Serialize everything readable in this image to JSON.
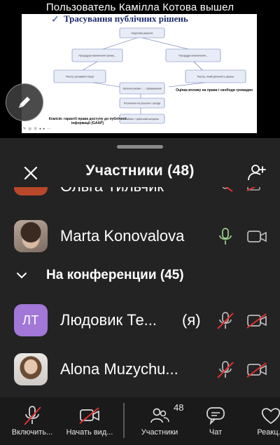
{
  "notification": {
    "text": "Пользователь Камілла Котова вышел"
  },
  "slide": {
    "title": "Трасування публічних рішень",
    "boxes": [
      "Ініціатива рішення",
      "Процедура визначення органу...",
      "Процедура визначення...",
      "Реєстр органу/інституції",
      "Реєстр, який/ діяльність рішень",
      "Загальні умови / ... / формування",
      "Посилання на рішення / заходи",
      "Кабінет / публічний контроль"
    ],
    "caption_left": "Комісія: гарантії права доступу до публічної інформації (GAAP)",
    "caption_right": "Оцінка впливу на права і свободи громадян",
    "toolbar_glyphs": "✎ ◎ ⊙ ◂ ▸ ⋯"
  },
  "panel": {
    "title": "Участники (48)",
    "partial_participant": "Ольга Тильчик",
    "participants_top": [
      {
        "name": "Marta Konovalova"
      }
    ],
    "section_label": "На конференции (45)",
    "participants": [
      {
        "initials": "ЛТ",
        "name": "Людовик Те...",
        "me": "(я)"
      },
      {
        "name": "Alona Muzychu..."
      }
    ]
  },
  "toolbar": {
    "mic_label": "Включить...",
    "video_label": "Начать вид...",
    "participants_label": "Участники",
    "participants_count": "48",
    "chat_label": "Чат",
    "reactions_label": "Реакц..."
  },
  "colors": {
    "panel_bg": "#232323",
    "toolbar_bg": "#1a1a1a",
    "muted_red": "#e0312f",
    "mic_active_green": "#9fcf8f",
    "initials_avatar": "#a277d8"
  },
  "icons": [
    "pencil-icon",
    "close-icon",
    "add-person-icon",
    "mic-icon",
    "mic-muted-icon",
    "camera-icon",
    "camera-off-icon",
    "chevron-down-icon",
    "participants-icon",
    "chat-icon",
    "heart-icon"
  ]
}
